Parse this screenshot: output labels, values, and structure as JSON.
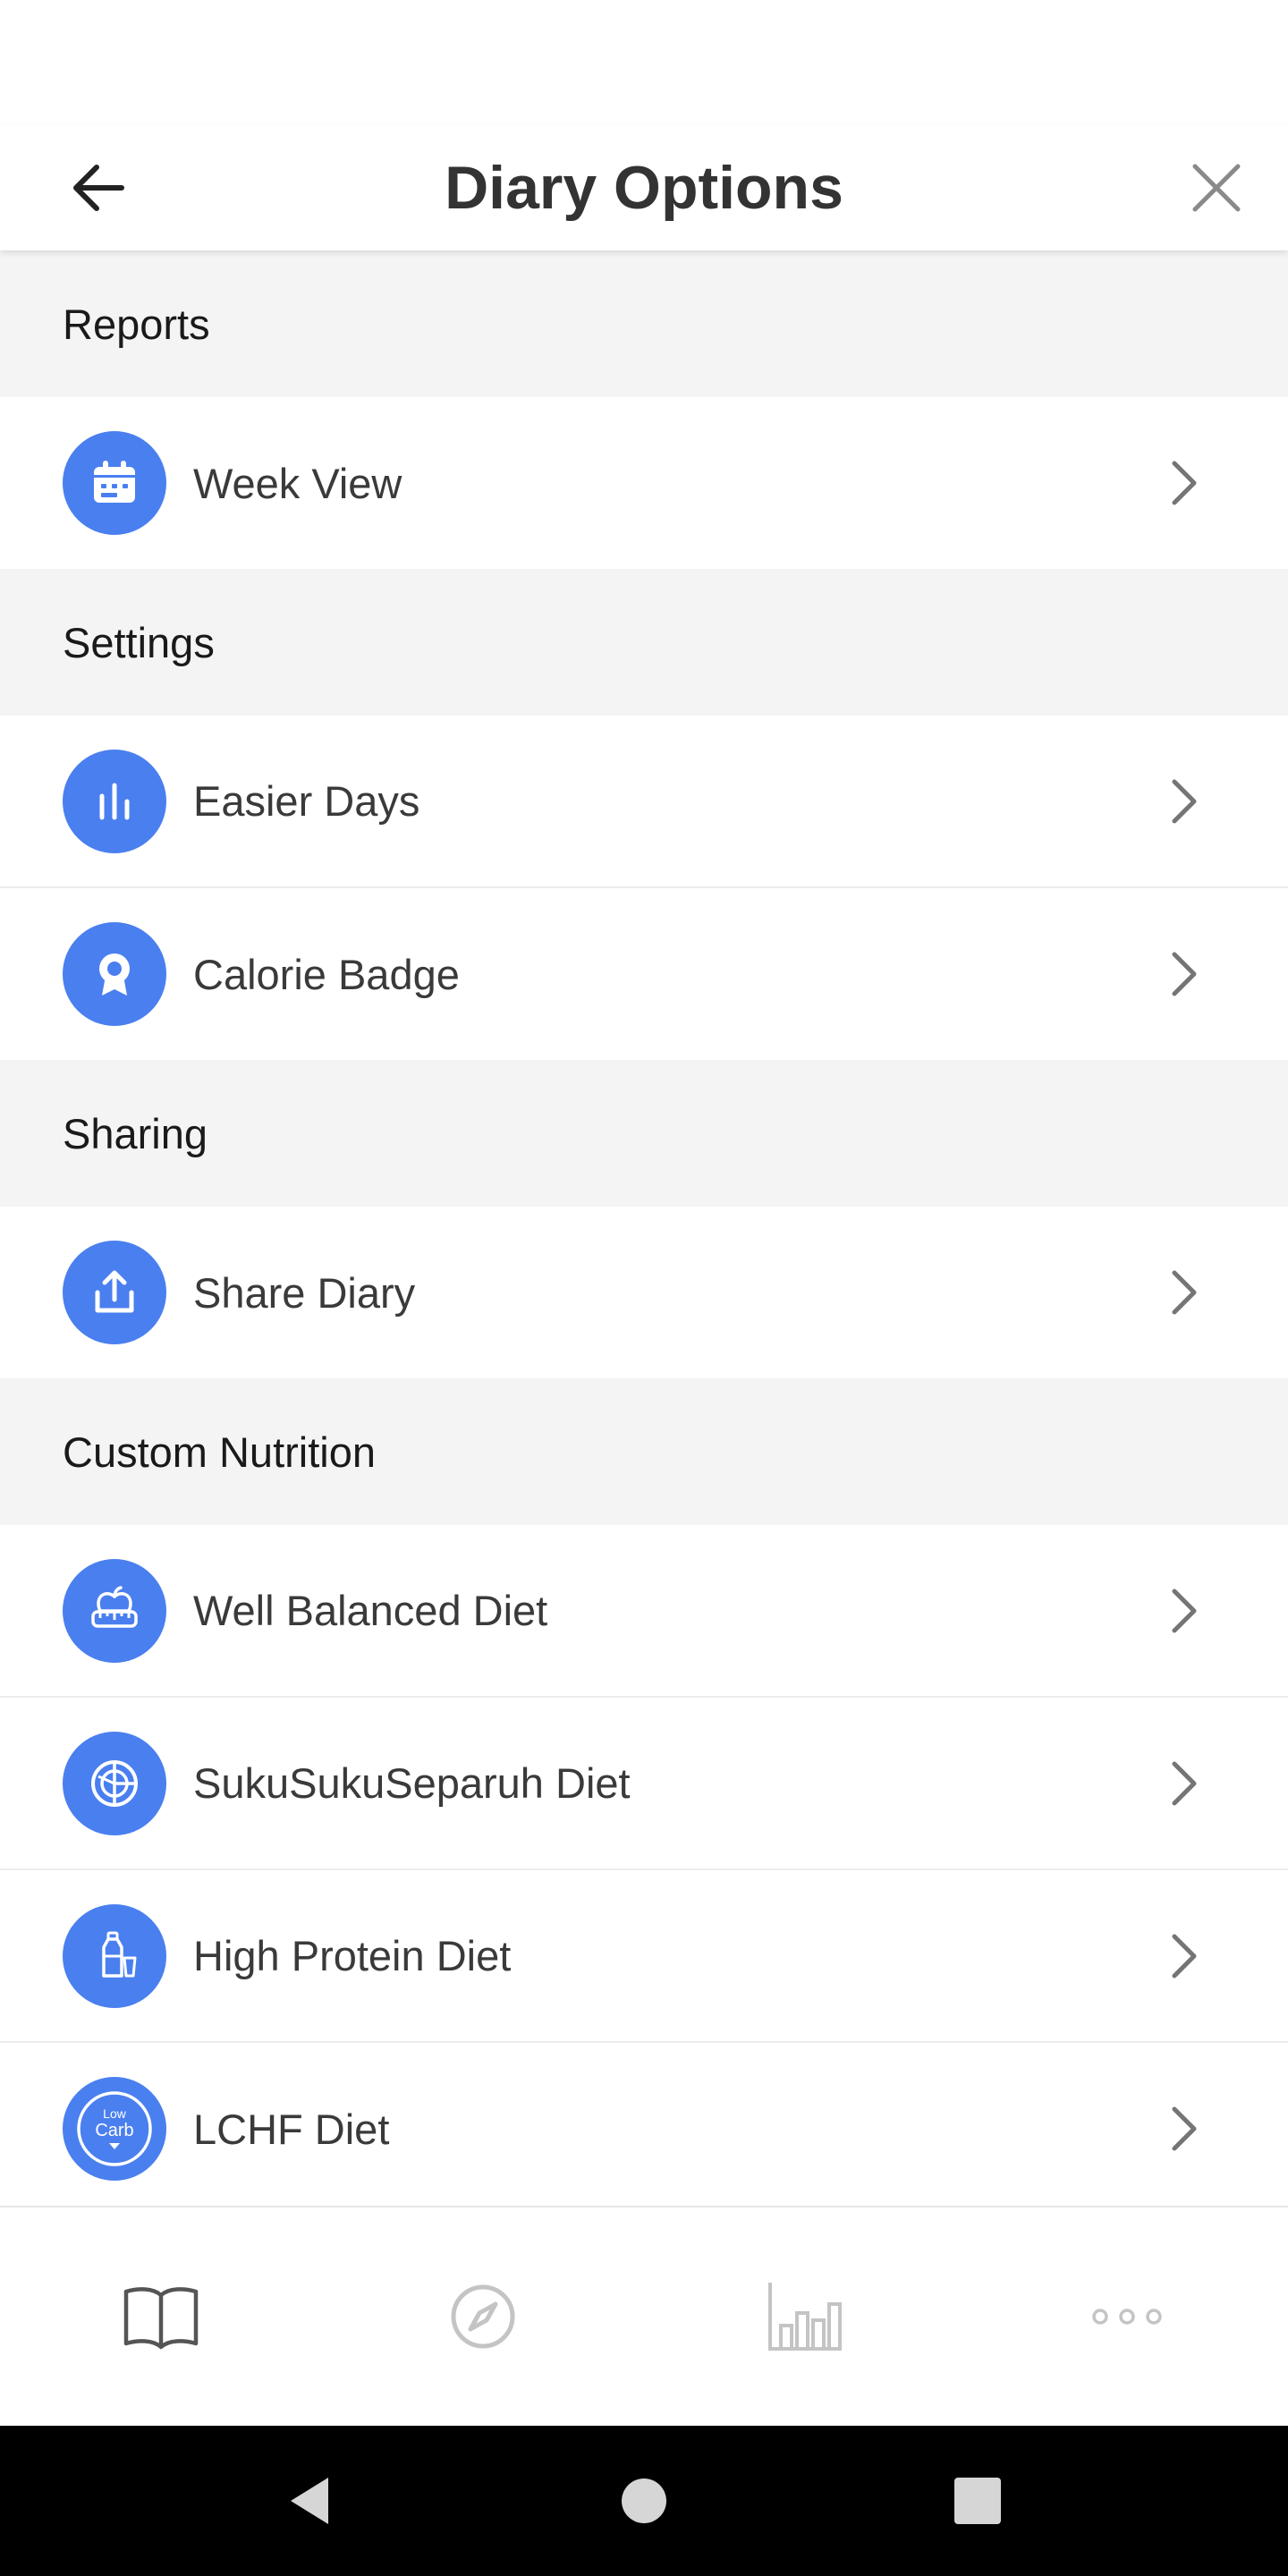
{
  "header": {
    "title": "Diary Options",
    "back_icon": "arrow-left-icon",
    "close_icon": "close-icon"
  },
  "sections": {
    "reports": {
      "title": "Reports",
      "items": [
        {
          "label": "Week View",
          "icon": "calendar-icon"
        }
      ]
    },
    "settings": {
      "title": "Settings",
      "items": [
        {
          "label": "Easier Days",
          "icon": "bar-chart-icon"
        },
        {
          "label": "Calorie Badge",
          "icon": "badge-ribbon-icon"
        }
      ]
    },
    "sharing": {
      "title": "Sharing",
      "items": [
        {
          "label": "Share Diary",
          "icon": "share-upload-icon"
        }
      ]
    },
    "custom_nutrition": {
      "title": "Custom Nutrition",
      "items": [
        {
          "label": "Well Balanced Diet",
          "icon": "apple-scale-icon"
        },
        {
          "label": "SukuSukuSeparuh Diet",
          "icon": "plate-sections-icon"
        },
        {
          "label": "High Protein Diet",
          "icon": "protein-bottle-icon"
        },
        {
          "label": "LCHF Diet",
          "icon": "low-carb-icon",
          "icon_text_top": "Low",
          "icon_text_main": "Carb"
        }
      ]
    }
  },
  "bottom_nav": {
    "tabs": [
      {
        "name": "diary",
        "icon": "book-icon",
        "active": true
      },
      {
        "name": "explore",
        "icon": "compass-icon",
        "active": false
      },
      {
        "name": "progress",
        "icon": "bar-chart-icon",
        "active": false
      },
      {
        "name": "more",
        "icon": "more-dots-icon",
        "active": false
      }
    ]
  },
  "system_nav": {
    "buttons": [
      "back-triangle-icon",
      "home-circle-icon",
      "recents-square-icon"
    ]
  },
  "colors": {
    "accent": "#4a7fef",
    "section_bg": "#f4f4f4",
    "text": "#333333",
    "chevron": "#757575",
    "nav_active": "#555555",
    "nav_inactive": "#c4c4c4"
  }
}
